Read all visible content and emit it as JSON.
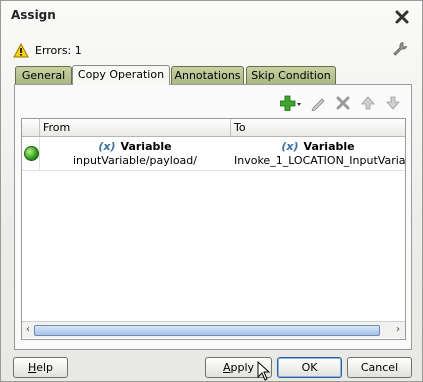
{
  "dialog": {
    "title": "Assign",
    "close_icon": "close-icon",
    "status": {
      "icon": "warning-icon",
      "text": "Errors: 1"
    },
    "settings_icon": "wrench-icon"
  },
  "tabs": [
    {
      "label": "General",
      "active": false
    },
    {
      "label": "Copy Operation",
      "active": true
    },
    {
      "label": "Annotations",
      "active": false
    },
    {
      "label": "Skip Condition",
      "active": false
    }
  ],
  "toolbar": {
    "icons": [
      "add-icon",
      "edit-icon",
      "delete-icon",
      "move-up-icon",
      "move-down-icon"
    ]
  },
  "table": {
    "columns": [
      "From",
      "To"
    ],
    "rows": [
      {
        "status_icon": "green-status-icon",
        "from": {
          "type_symbol": "(x)",
          "type": "Variable",
          "path": "inputVariable/payload/"
        },
        "to": {
          "type_symbol": "(x)",
          "type": "Variable",
          "path": "Invoke_1_LOCATION_InputVariabl"
        }
      }
    ]
  },
  "buttons": {
    "help": {
      "prefix": "",
      "mnemonic": "H",
      "rest": "elp"
    },
    "apply": {
      "prefix": "",
      "mnemonic": "A",
      "rest": "pply"
    },
    "ok": "OK",
    "cancel": "Cancel"
  },
  "colors": {
    "tab_green": "#aab883",
    "accent_blue": "#2d5fa3",
    "variable_icon": "#3a6fb0"
  }
}
